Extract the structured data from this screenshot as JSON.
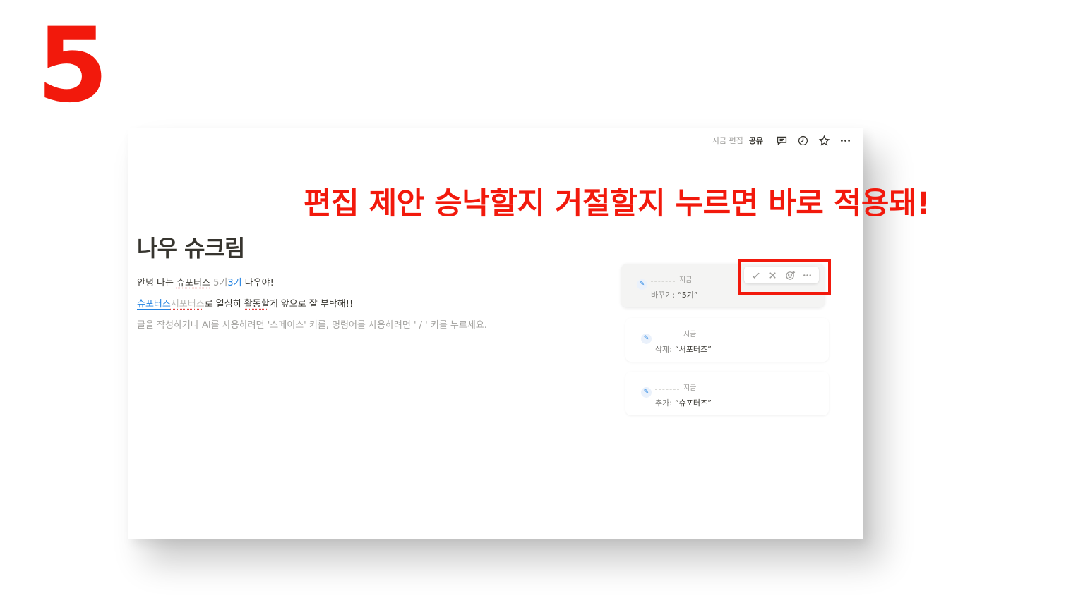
{
  "overlay": {
    "step_number": "5",
    "headline": "편집 제안 승낙할지 거절할지 누르면 바로 적용돼!"
  },
  "topbar": {
    "edited": "지금 편집",
    "share": "공유",
    "icons": [
      "comment-icon",
      "clock-icon",
      "star-icon",
      "more-icon"
    ]
  },
  "page": {
    "title": "나우 슈크림",
    "line1": {
      "prefix": "안녕 나는 ",
      "word": "슈포터즈",
      "space": " ",
      "removed": "5기",
      "inserted": "3기",
      "suffix": " 나우야!"
    },
    "line2": {
      "inserted": "슈포터즈",
      "removed": "서포터즈",
      "text1": "로 열심히 ",
      "underlined": "활동할",
      "text2": "게 앞으로 잘 부탁해!!"
    },
    "placeholder": "글을 작성하거나 AI를 사용하려면 '스페이스' 키를, 명령어를 사용하려면 ' / ' 키를 누르세요."
  },
  "suggestions": [
    {
      "time": "지금",
      "action": "바꾸기:",
      "value": "“5기”"
    },
    {
      "time": "지금",
      "action": "삭제:",
      "value": "“서포터즈”"
    },
    {
      "time": "지금",
      "action": "추가:",
      "value": "“슈포터즈”"
    }
  ],
  "colors": {
    "accent_red": "#f2190c",
    "inserted_blue": "#2383e2",
    "muted_text": "#9b9a97"
  }
}
